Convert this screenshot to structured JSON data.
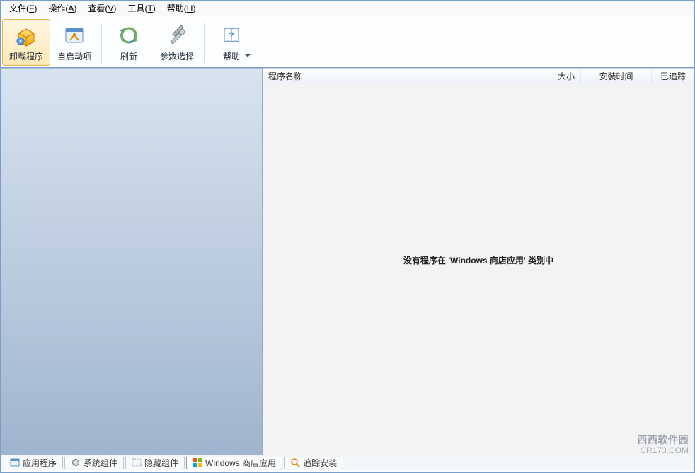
{
  "menu": {
    "file": {
      "label": "文件",
      "mnemonic": "F"
    },
    "action": {
      "label": "操作",
      "mnemonic": "A"
    },
    "view": {
      "label": "查看",
      "mnemonic": "V"
    },
    "tools": {
      "label": "工具",
      "mnemonic": "T"
    },
    "help": {
      "label": "帮助",
      "mnemonic": "H"
    }
  },
  "toolbar": {
    "uninstall_label": "卸载程序",
    "startup_label": "自启动项",
    "refresh_label": "刷新",
    "options_label": "参数选择",
    "help_label": "帮助"
  },
  "columns": {
    "program_name": "程序名称",
    "size": "大小",
    "install_time": "安装时间",
    "tracked": "已追踪"
  },
  "empty_state": "没有程序在 'Windows 商店应用' 类别中",
  "tabs": {
    "applications": "应用程序",
    "system_components": "系统组件",
    "hidden_components": "隐藏组件",
    "windows_store": "Windows 商店应用",
    "track_install": "追踪安装"
  },
  "watermark": {
    "name": "西西软件园",
    "url": "CR173.COM"
  }
}
